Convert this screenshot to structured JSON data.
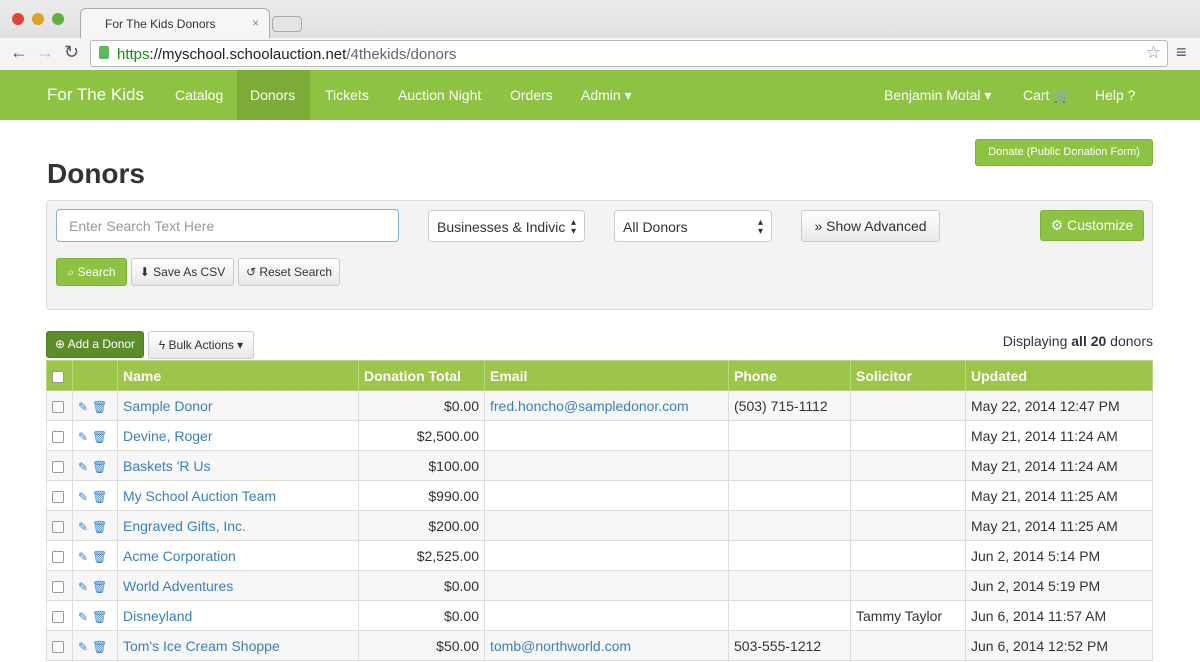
{
  "browser": {
    "tab_title": "For The Kids Donors",
    "url_scheme": "https",
    "url_host": "://myschool.schoolauction.net",
    "url_path": "/4thekids/donors"
  },
  "nav": {
    "brand": "For The Kids",
    "items": [
      "Catalog",
      "Donors",
      "Tickets",
      "Auction Night",
      "Orders",
      "Admin ▾"
    ],
    "user": "Benjamin Motal ▾",
    "cart": "Cart 🛒",
    "help": "Help ?"
  },
  "page": {
    "title": "Donors",
    "donate_button": "Donate (Public Donation Form)"
  },
  "search": {
    "placeholder": "Enter Search Text Here",
    "type_select": "Businesses & Indivic",
    "donor_select": "All Donors",
    "advanced": "» Show Advanced",
    "customize": "⚙ Customize",
    "search": "⌕ Search",
    "csv": "⬇ Save As CSV",
    "reset": "↺ Reset Search"
  },
  "actions": {
    "add": "⊕ Add a Donor",
    "bulk": "ϟ Bulk Actions ▾",
    "display_prefix": "Displaying ",
    "display_bold": "all 20",
    "display_suffix": " donors"
  },
  "table": {
    "headers": [
      "Name",
      "Donation Total",
      "Email",
      "Phone",
      "Solicitor",
      "Updated"
    ],
    "rows": [
      [
        "Sample Donor",
        "$0.00",
        "fred.honcho@sampledonor.com",
        "(503) 715-1112",
        "",
        "May 22, 2014 12:47 PM"
      ],
      [
        "Devine, Roger",
        "$2,500.00",
        "",
        "",
        "",
        "May 21, 2014 11:24 AM"
      ],
      [
        "Baskets 'R Us",
        "$100.00",
        "",
        "",
        "",
        "May 21, 2014 11:24 AM"
      ],
      [
        "My School Auction Team",
        "$990.00",
        "",
        "",
        "",
        "May 21, 2014 11:25 AM"
      ],
      [
        "Engraved Gifts, Inc.",
        "$200.00",
        "",
        "",
        "",
        "May 21, 2014 11:25 AM"
      ],
      [
        "Acme Corporation",
        "$2,525.00",
        "",
        "",
        "",
        "Jun 2, 2014 5:14 PM"
      ],
      [
        "World Adventures",
        "$0.00",
        "",
        "",
        "",
        "Jun 2, 2014 5:19 PM"
      ],
      [
        "Disneyland",
        "$0.00",
        "",
        "",
        "Tammy Taylor",
        "Jun 6, 2014 11:57 AM"
      ],
      [
        "Tom's Ice Cream Shoppe",
        "$50.00",
        "tomb@northworld.com",
        "503-555-1212",
        "",
        "Jun 6, 2014 12:52 PM"
      ]
    ]
  }
}
